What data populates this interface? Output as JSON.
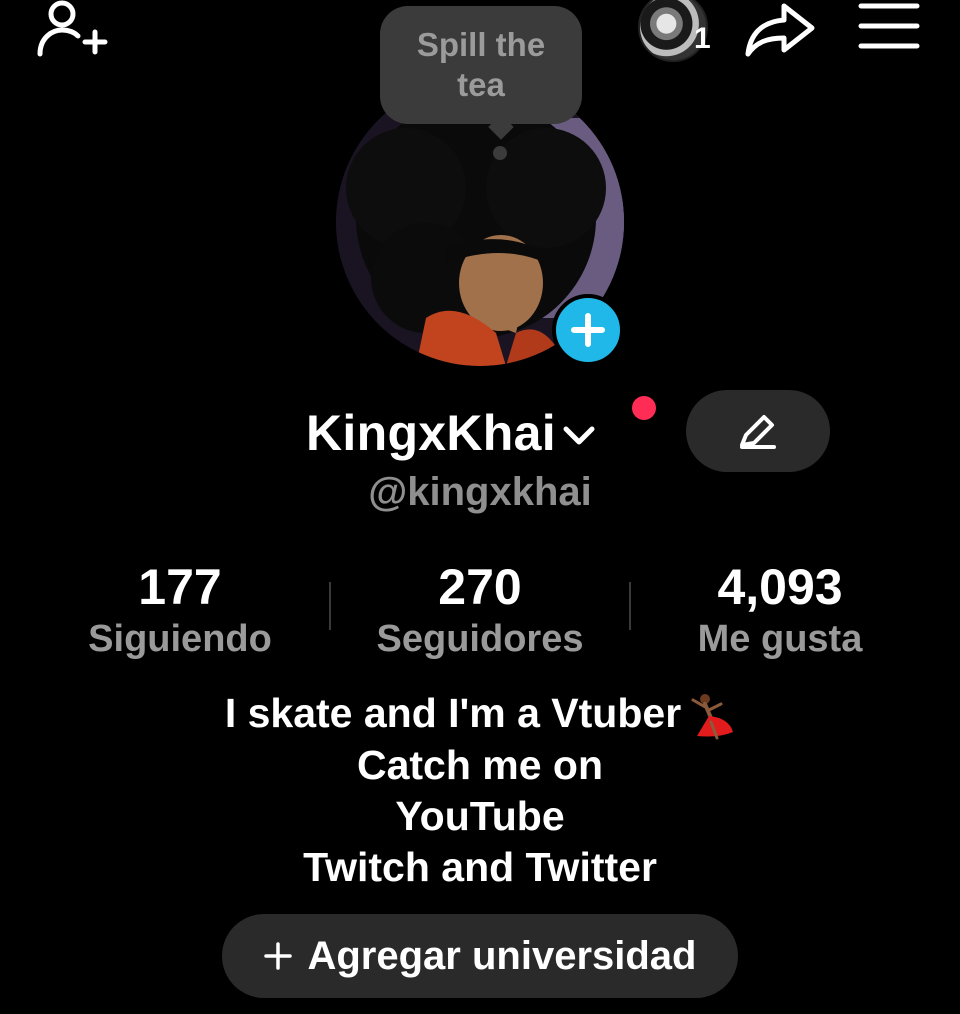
{
  "top_bar": {
    "add_friend_icon": "user-plus-icon",
    "story_count": "1",
    "share_icon": "share-arrow-icon",
    "menu_icon": "hamburger-menu-icon"
  },
  "tooltip": {
    "text_line1": "Spill the",
    "text_line2": "tea"
  },
  "profile": {
    "display_name": "KingxKhai",
    "handle": "@kingxkhai",
    "accent_add_color": "#20b8e8",
    "notification_color": "#ff2d55"
  },
  "stats": [
    {
      "value": "177",
      "label": "Siguiendo"
    },
    {
      "value": "270",
      "label": "Seguidores"
    },
    {
      "value": "4,093",
      "label": "Me gusta"
    }
  ],
  "bio": {
    "line1": "I skate and I'm a Vtuber",
    "line2": "Catch me on",
    "line3": "YouTube",
    "line4": "Twitch and Twitter",
    "emoji_icon": "dancer-emoji-icon"
  },
  "actions": {
    "add_university_label": "Agregar universidad"
  }
}
